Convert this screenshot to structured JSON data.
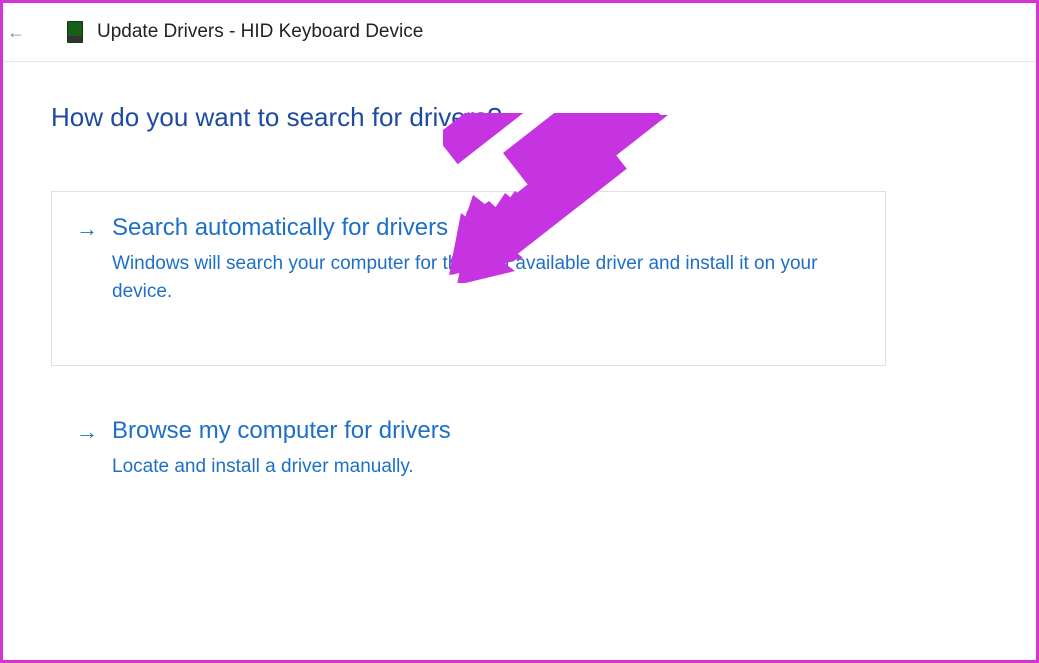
{
  "header": {
    "title": "Update Drivers - HID Keyboard Device"
  },
  "page": {
    "heading": "How do you want to search for drivers?"
  },
  "options": [
    {
      "title": "Search automatically for drivers",
      "description": "Windows will search your computer for the best available driver and install it on your device."
    },
    {
      "title": "Browse my computer for drivers",
      "description": "Locate and install a driver manually."
    }
  ],
  "annotation": {
    "color": "#c633e0"
  }
}
